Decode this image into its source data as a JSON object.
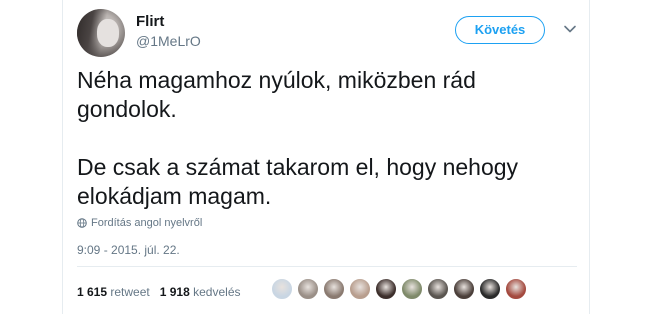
{
  "tweet": {
    "display_name": "Flirt",
    "handle": "@1MeLrO",
    "follow_label": "Követés",
    "text_paragraphs": [
      "Néha magamhoz nyúlok, miközben rád gondolok.",
      "De csak a számat takarom el, hogy nehogy elokádjam magam."
    ],
    "translate_label": "Fordítás angol nyelvről",
    "timestamp": "9:09 - 2015. júl. 22."
  },
  "stats": {
    "retweet_count": "1 615",
    "retweet_label": "retweet",
    "like_count": "1 918",
    "like_label": "kedvelés"
  },
  "icons": {
    "more": "chevron-down-icon",
    "translate": "globe-icon"
  },
  "colors": {
    "accent": "#1da1f2",
    "secondary_text": "#657786",
    "divider": "#e6ecf0"
  },
  "liker_avatars": [
    {
      "color": "#c9d6e3"
    },
    {
      "color": "#9a8f87"
    },
    {
      "color": "#8a7a70"
    },
    {
      "color": "#b89e8e"
    },
    {
      "color": "#3d2f2c"
    },
    {
      "color": "#7f8a6a"
    },
    {
      "color": "#5a5550"
    },
    {
      "color": "#4b3f3a"
    },
    {
      "color": "#2a2a2a"
    },
    {
      "color": "#a44a3f"
    }
  ]
}
